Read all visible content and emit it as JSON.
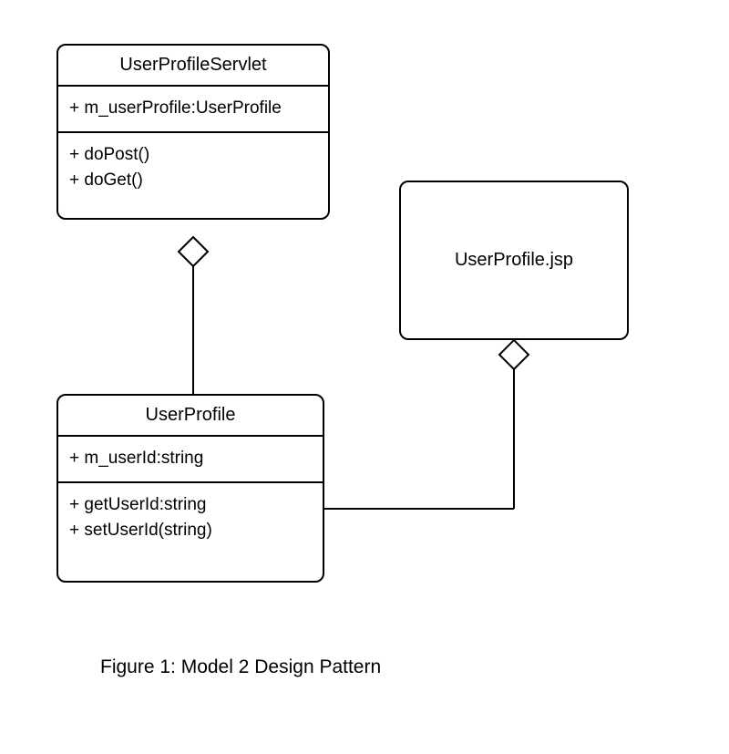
{
  "diagram": {
    "caption": "Figure 1: Model 2 Design Pattern",
    "classes": {
      "servlet": {
        "name": "UserProfileServlet",
        "attributes": [
          "+ m_userProfile:UserProfile"
        ],
        "methods": [
          "+ doPost()",
          "+ doGet()"
        ]
      },
      "jsp": {
        "name": "UserProfile.jsp"
      },
      "profile": {
        "name": "UserProfile",
        "attributes": [
          "+ m_userId:string"
        ],
        "methods": [
          "+ getUserId:string",
          "+ setUserId(string)"
        ]
      }
    },
    "relationships": [
      {
        "from": "servlet",
        "to": "profile",
        "type": "aggregation"
      },
      {
        "from": "jsp",
        "to": "profile",
        "type": "aggregation"
      }
    ]
  }
}
